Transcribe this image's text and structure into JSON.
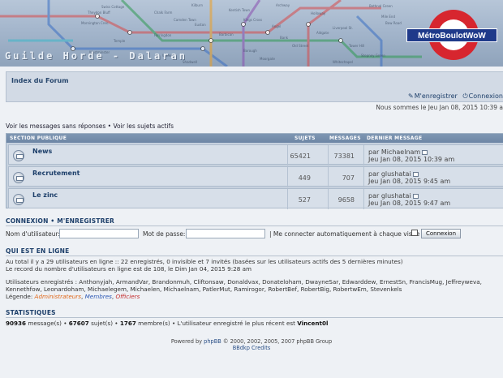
{
  "header": {
    "guild_title": "Guilde Horde - Dalaran",
    "logo_text": "MétroBoulotWoW",
    "map_labels": [
      "Kilburn",
      "Swiss Cottage",
      "Chalk Farm",
      "Theydon Bluff",
      "Kentish Town",
      "Archway",
      "Camden Town",
      "Mornington Cres.",
      "Holloway",
      "Euston",
      "Kings Cross",
      "Angel",
      "Farringdon",
      "Barbican",
      "Liverpool St.",
      "Bank",
      "Temple",
      "Tower Hill",
      "Aldgate",
      "Westminster",
      "Waterloo",
      "Borough",
      "Bethnal Green",
      "Mile End",
      "Bow Road",
      "Old Street",
      "Moorgate",
      "Stepney Green",
      "Whitechapel",
      "Shadwell"
    ]
  },
  "nav": {
    "title": "Index du Forum",
    "register": "M'enregistrer",
    "login": "Connexion",
    "dateline": "Nous sommes le Jeu Jan 08, 2015 10:39 a",
    "quick_links": "Voir les messages sans réponses • Voir les sujets actifs"
  },
  "forums": {
    "headers": {
      "section": "SECTION PUBLIQUE",
      "topics": "SUJETS",
      "posts": "MESSAGES",
      "last": "DERNIER MESSAGE"
    },
    "rows": [
      {
        "name": "News",
        "topics": "65421",
        "posts": "73381",
        "last_by": "par Michaelnam",
        "last_date": "Jeu Jan 08, 2015 10:39 am"
      },
      {
        "name": "Recrutement",
        "topics": "449",
        "posts": "707",
        "last_by": "par glushatai",
        "last_date": "Jeu Jan 08, 2015 9:45 am"
      },
      {
        "name": "Le zinc",
        "topics": "527",
        "posts": "9658",
        "last_by": "par glushatai",
        "last_date": "Jeu Jan 08, 2015 9:47 am"
      }
    ]
  },
  "login": {
    "heading": "CONNEXION  •  M'ENREGISTRER",
    "user_label": "Nom d'utilisateur:",
    "pass_label": "Mot de passe:",
    "auto_label": "| Me connecter automatiquement à chaque visite",
    "button": "Connexion"
  },
  "online": {
    "heading": "QUI EST EN LIGNE",
    "line1": "Au total il y a 29 utilisateurs en ligne :: 22 enregistrés, 0 invisible et 7 invités (basées sur les utilisateurs actifs des 5 dernières minutes)",
    "line2": "Le record du nombre d'utilisateurs en ligne est de 108, le Dim Jan 04, 2015 9:28 am",
    "users_line1": "Utilisateurs enregistrés : Anthonyjah, ArmandVar, Brandonmuh, Cliftonsaw, Donaldvax, Donateloham, DwayneSar, Edwarddew, ErnestSn, FrancisMug, Jeffreyweva,",
    "users_line2": "Kennethfow, Leonardoham, Michaelegem, Michaelen, Michaelnam, PatlerMut, Ramirogor, RobertBef, RobertBig, RobertwEm, Stevenkels",
    "legend_label": "Légende:",
    "legend_admins": "Administrateurs",
    "legend_members": "Membres",
    "legend_officers": "Officiers"
  },
  "stats": {
    "heading": "STATISTIQUES",
    "messages": "90936",
    "messages_label": "message(s) •",
    "topics": "67607",
    "topics_label": "sujet(s) •",
    "members": "1767",
    "members_label": "membre(s) • L'utilisateur enregistré le plus récent est",
    "newest": "Vincent0l"
  },
  "footer": {
    "powered_prefix": "Powered by",
    "phpbb": "phpBB",
    "powered_suffix": "© 2000, 2002, 2005, 2007 phpBB Group",
    "credits": "BBdkp Credits"
  }
}
